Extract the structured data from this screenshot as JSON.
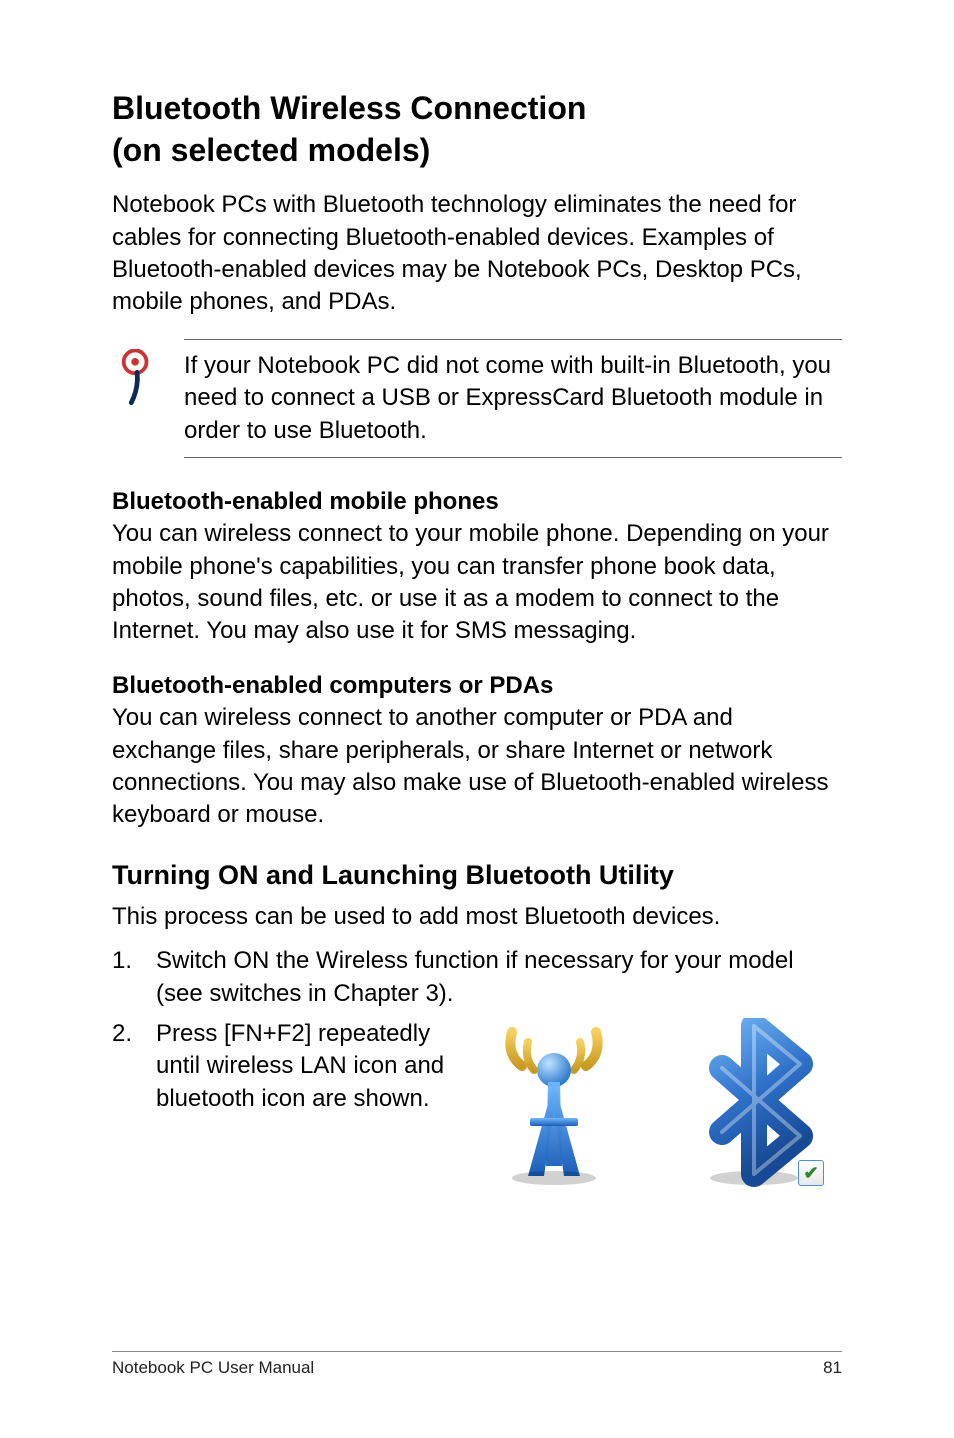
{
  "heading": {
    "line1": "Bluetooth Wireless Connection",
    "line2": "(on selected models)"
  },
  "intro": "Notebook PCs with Bluetooth technology eliminates the need for cables for connecting Bluetooth-enabled devices. Examples of Bluetooth-enabled devices may be Notebook PCs, Desktop PCs, mobile phones, and PDAs.",
  "note": "If your Notebook PC did not come with built-in Bluetooth, you need to connect a USB or ExpressCard Bluetooth module in order to use Bluetooth.",
  "section1": {
    "title": "Bluetooth-enabled mobile phones",
    "body": "You can wireless connect to your mobile phone. Depending on your mobile phone's capabilities, you can transfer phone book data, photos, sound files, etc. or use it as a modem to connect to the Internet. You may also use it for SMS messaging."
  },
  "section2": {
    "title": "Bluetooth-enabled computers or PDAs",
    "body": "You can wireless connect to another computer or PDA and exchange files, share peripherals, or share Internet or network connections. You may also make use of Bluetooth-enabled wireless keyboard or mouse."
  },
  "subheading": "Turning ON and Launching Bluetooth Utility",
  "subintro": "This process can be used to add most Bluetooth devices.",
  "steps": {
    "s1num": "1.",
    "s1": "Switch ON the Wireless function if necessary for your model (see switches in Chapter 3).",
    "s2num": "2.",
    "s2": "Press [FN+F2] repeatedly until wireless LAN icon and bluetooth icon are shown."
  },
  "footer": {
    "left": "Notebook PC User Manual",
    "right": "81"
  },
  "icons": {
    "pin": "pin-icon",
    "wifi": "wifi-antenna-icon",
    "bluetooth": "bluetooth-icon",
    "check": "✔"
  }
}
